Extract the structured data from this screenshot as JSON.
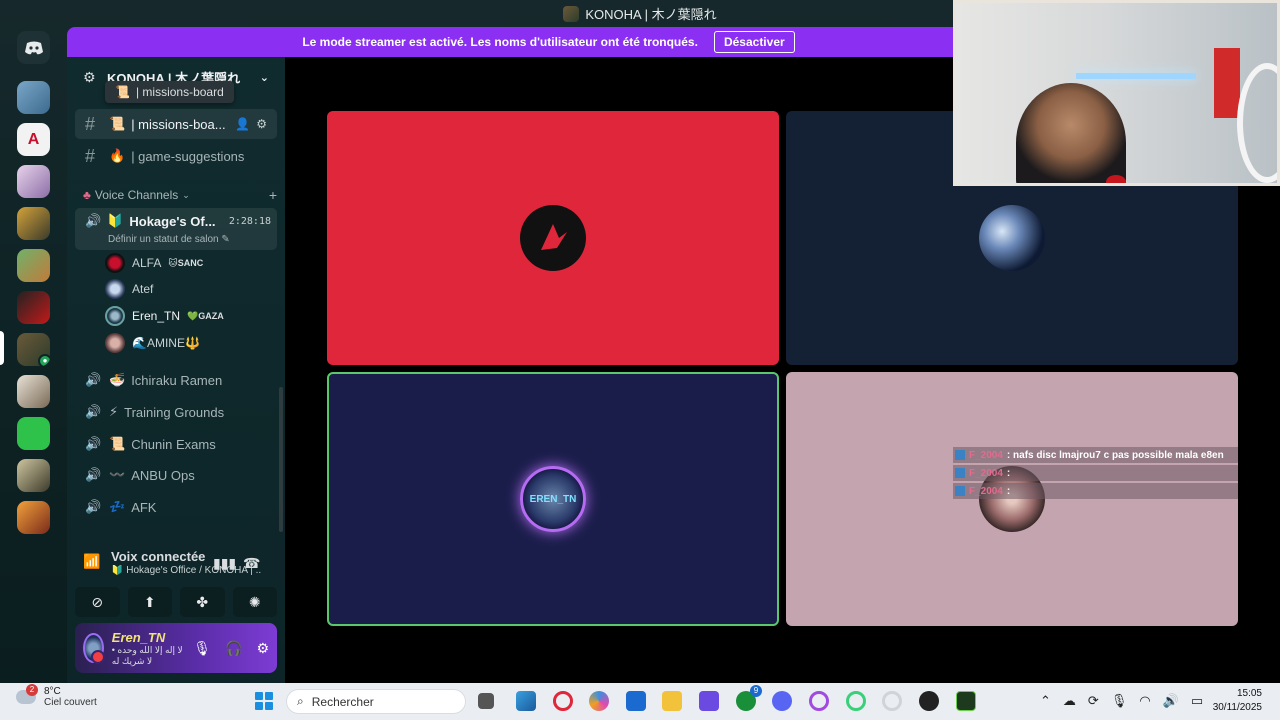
{
  "window": {
    "title": "KONOHA | 木ノ葉隠れ"
  },
  "banner": {
    "text": "Le mode streamer est activé. Les noms d'utilisateur ont été tronqués.",
    "button": "Désactiver"
  },
  "server": {
    "name": "KONOHA | 木ノ葉隠れ"
  },
  "tooltip": {
    "emoji": "📜",
    "text": "| missions-board"
  },
  "channels": {
    "text": [
      {
        "emoji": "📜",
        "name": "| missions-boa..."
      },
      {
        "emoji": "🔥",
        "name": "| game-suggestions"
      }
    ],
    "voice_category": "Voice Channels",
    "active_voice": {
      "emoji": "🔰",
      "name": "Hokage's Of...",
      "time": "2:28:18",
      "status": "Définir un statut de salon"
    },
    "members": [
      {
        "name": "ALFA",
        "tag": "🐱SANC"
      },
      {
        "name": "Atef",
        "tag": ""
      },
      {
        "name": "Eren_TN",
        "tag": "💚GAZA"
      },
      {
        "name": "🌊AMINE🔱",
        "tag": ""
      }
    ],
    "voice": [
      {
        "emoji": "🍜",
        "name": "Ichiraku Ramen"
      },
      {
        "emoji": "⚡",
        "name": "Training Grounds"
      },
      {
        "emoji": "📜",
        "name": "Chunin Exams"
      },
      {
        "emoji": "〰️",
        "name": "ANBU Ops"
      },
      {
        "emoji": "💤",
        "name": "AFK"
      }
    ]
  },
  "voice_connected": {
    "title": "Voix connectée",
    "subtitle": "🔰 Hokage's Office / KONOHA | ..."
  },
  "user": {
    "name": "Eren_TN",
    "status": "• لا إله إلا الله وحده لا شريك له"
  },
  "stage": {
    "eren_label": "EREN_TN",
    "chat": [
      {
        "name": "F_2004",
        "message": ": nafs disc lmajrou7 c pas possible mala e8en"
      },
      {
        "name": "F_2004",
        "message": ":"
      },
      {
        "name": "F_2004",
        "message": ":"
      }
    ]
  },
  "taskbar": {
    "weather_temp": "8°C",
    "weather_desc": "Ciel couvert",
    "weather_badge": "2",
    "search_placeholder": "Rechercher",
    "time": "15:05",
    "date": "30/11/2025",
    "xbox_badge": "9"
  },
  "colors": {
    "banner": "#8b2ff2",
    "tile_red": "#e0263a",
    "tile_navy": "#142033",
    "tile_indigo": "#1a1d4a",
    "tile_pink": "#c4a4ae",
    "speaking_border": "#5ac86a"
  }
}
